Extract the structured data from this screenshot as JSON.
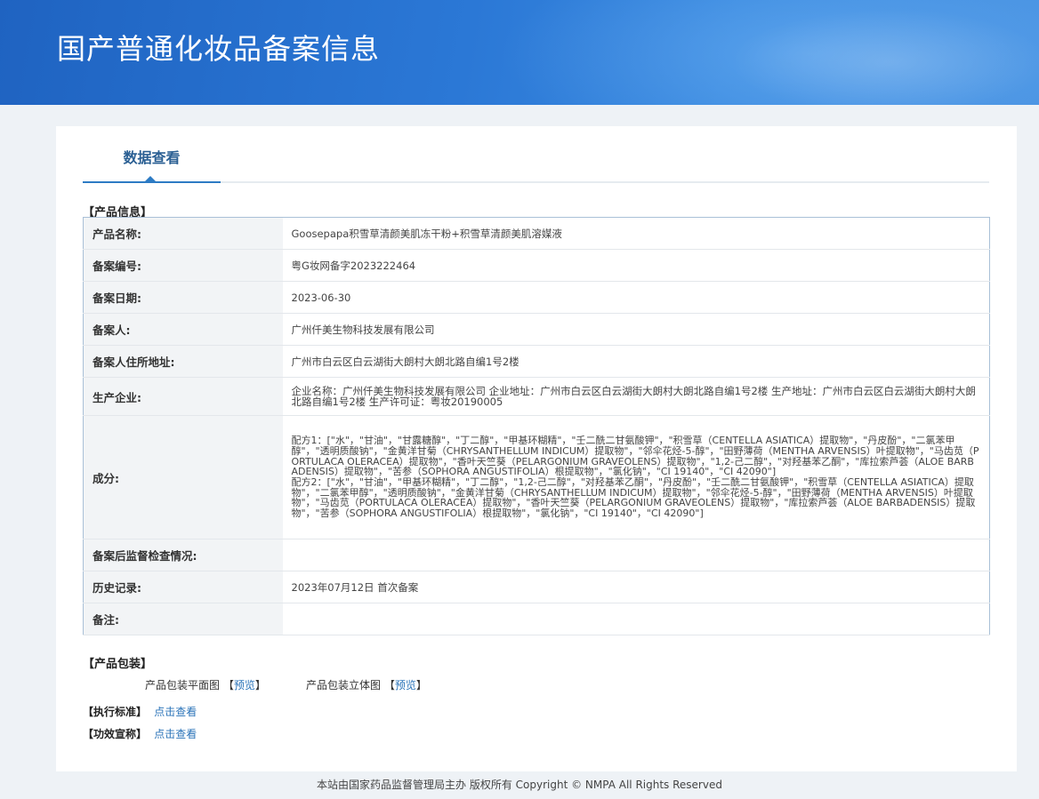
{
  "header": {
    "title": "国产普通化妆品备案信息"
  },
  "tabs": [
    {
      "label": "数据查看"
    }
  ],
  "product_info": {
    "section_title": "【产品信息】",
    "rows": [
      {
        "label": "产品名称:",
        "value": "Goosepapa积雪草清颜美肌冻干粉+积雪草清颜美肌溶媒液"
      },
      {
        "label": "备案编号:",
        "value": "粤G妆网备字2023222464"
      },
      {
        "label": "备案日期:",
        "value": "2023-06-30"
      },
      {
        "label": "备案人:",
        "value": "广州仟美生物科技发展有限公司"
      },
      {
        "label": "备案人住所地址:",
        "value": "广州市白云区白云湖街大朗村大朗北路自编1号2楼"
      },
      {
        "label": "生产企业:",
        "value": "企业名称：广州仟美生物科技发展有限公司 企业地址：广州市白云区白云湖街大朗村大朗北路自编1号2楼 生产地址：广州市白云区白云湖街大朗村大朗北路自编1号2楼 生产许可证：粤妆20190005"
      },
      {
        "label": "成分:",
        "value": "配方1：[\"水\"，\"甘油\"，\"甘露糖醇\"，\"丁二醇\"，\"甲基环糊精\"，\"壬二酰二甘氨酸钾\"，\"积雪草（CENTELLA ASIATICA）提取物\"，\"丹皮酚\"，\"二氯苯甲醇\"，\"透明质酸钠\"，\"金黄洋甘菊（CHRYSANTHELLUM INDICUM）提取物\"，\"邻伞花烃-5-醇\"，\"田野薄荷（MENTHA ARVENSIS）叶提取物\"，\"马齿苋（PORTULACA OLERACEA）提取物\"，\"香叶天竺葵（PELARGONIUM GRAVEOLENS）提取物\"，\"1,2-己二醇\"，\"对羟基苯乙酮\"，\"库拉索芦荟（ALOE BARBADENSIS）提取物\"，\"苦参（SOPHORA ANGUSTIFOLIA）根提取物\"，\"氯化钠\"，\"CI 19140\"，\"CI 42090\"]\n配方2：[\"水\"，\"甘油\"，\"甲基环糊精\"，\"丁二醇\"，\"1,2-己二醇\"，\"对羟基苯乙酮\"，\"丹皮酚\"，\"壬二酰二甘氨酸钾\"，\"积雪草（CENTELLA ASIATICA）提取物\"，\"二氯苯甲醇\"，\"透明质酸钠\"，\"金黄洋甘菊（CHRYSANTHELLUM INDICUM）提取物\"，\"邻伞花烃-5-醇\"，\"田野薄荷（MENTHA ARVENSIS）叶提取物\"，\"马齿苋（PORTULACA OLERACEA）提取物\"，\"香叶天竺葵（PELARGONIUM GRAVEOLENS）提取物\"，\"库拉索芦荟（ALOE BARBADENSIS）提取物\"，\"苦参（SOPHORA ANGUSTIFOLIA）根提取物\"，\"氯化钠\"，\"CI 19140\"，\"CI 42090\"]"
      },
      {
        "label": "备案后监督检查情况:",
        "value": ""
      },
      {
        "label": "历史记录:",
        "value": "2023年07月12日 首次备案"
      },
      {
        "label": "备注:",
        "value": ""
      }
    ]
  },
  "packaging": {
    "section_title": "【产品包装】",
    "flat_label": "产品包装平面图",
    "solid_label": "产品包装立体图",
    "bracket_open": "【",
    "bracket_close": "】",
    "preview_link": "预览"
  },
  "standard": {
    "label": "【执行标准】",
    "link": "点击查看"
  },
  "efficacy": {
    "label": "【功效宣称】",
    "link": "点击查看"
  },
  "footer": {
    "text": "本站由国家药品监督管理局主办 版权所有 Copyright © NMPA All Rights Reserved"
  },
  "colors": {
    "header_blue": "#2b78d6",
    "link_blue": "#2a73b8",
    "tab_blue": "#2d7bc4"
  }
}
